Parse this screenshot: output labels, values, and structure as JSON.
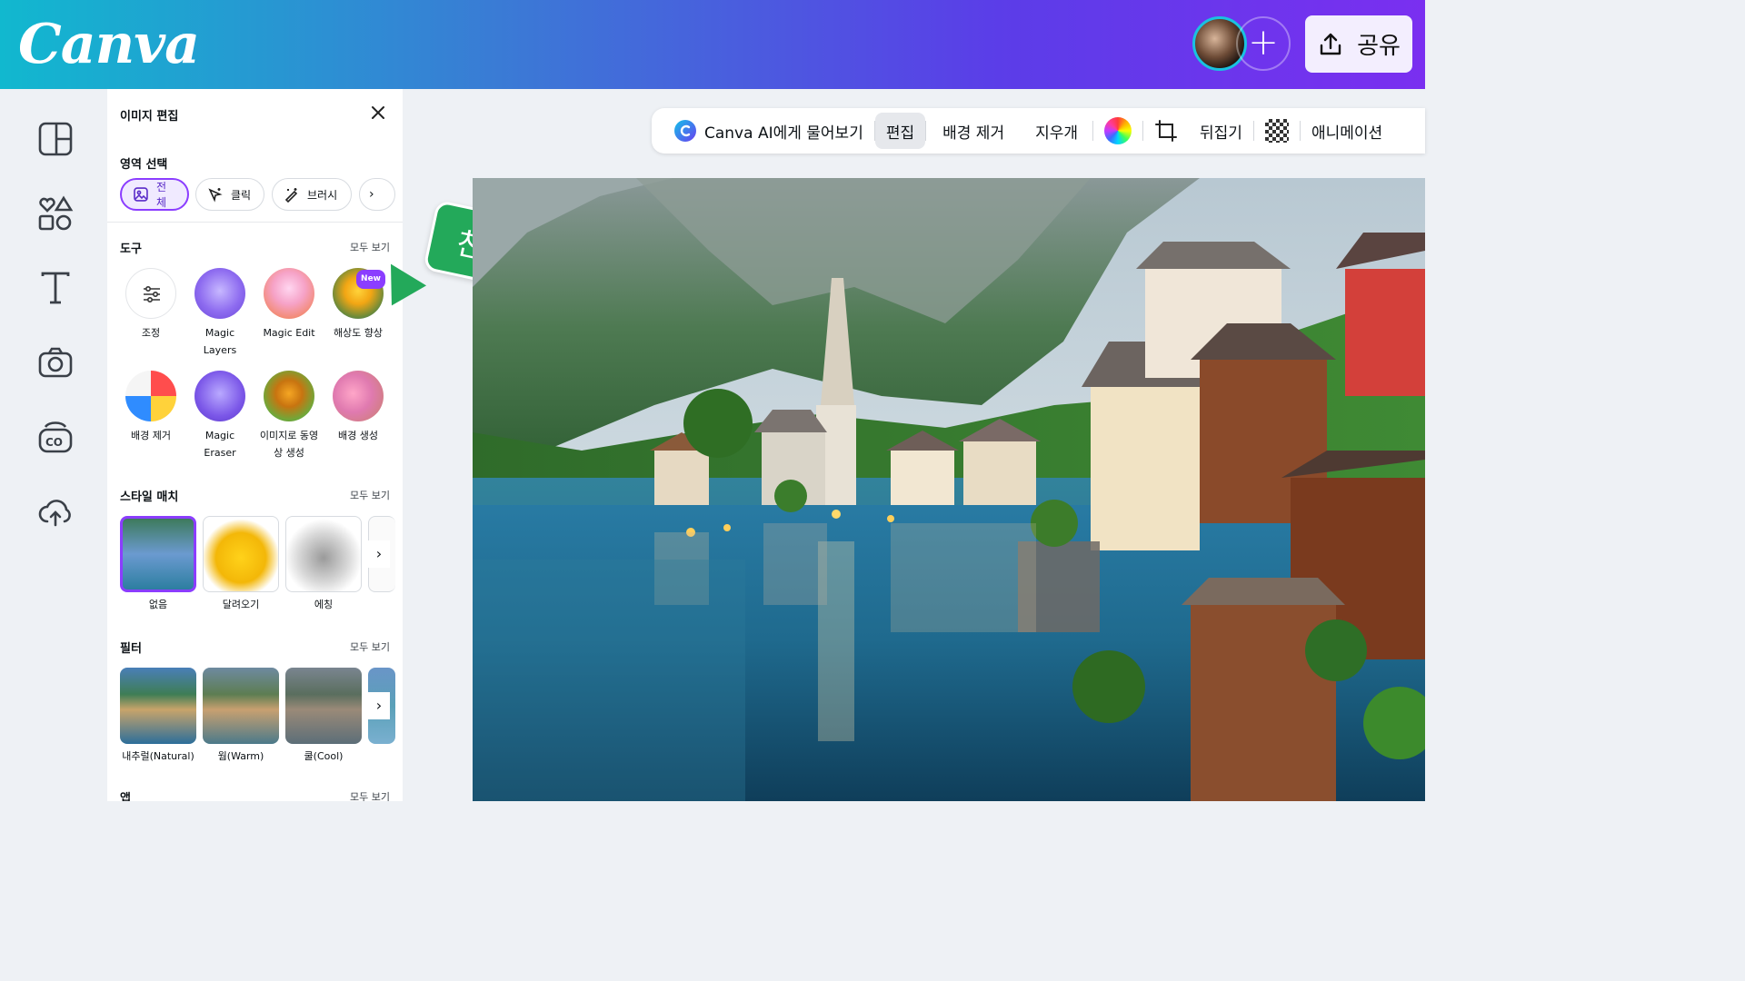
{
  "header": {
    "logo": "Canva",
    "add_collaborator": "+",
    "share_label": "공유"
  },
  "panel": {
    "title": "이미지 편집",
    "selection": {
      "title": "영역 선택",
      "chips": [
        "전체",
        "클릭",
        "브러시"
      ]
    },
    "tools": {
      "title": "도구",
      "see_all": "모두 보기",
      "items": [
        "조정",
        "Magic Layers",
        "Magic Edit",
        "해상도 향상",
        "배경 제거",
        "Magic Eraser",
        "이미지로 동영상 생성",
        "배경 생성"
      ],
      "new_badge": "New"
    },
    "style_match": {
      "title": "스타일 매치",
      "see_all": "모두 보기",
      "items": [
        "없음",
        "달려오기",
        "에칭"
      ]
    },
    "filters": {
      "title": "필터",
      "see_all": "모두 보기",
      "items": [
        "내추럴(Natural)",
        "웜(Warm)",
        "쿨(Cool)"
      ]
    },
    "apps": {
      "title": "앱",
      "see_all": "모두 보기"
    }
  },
  "toolbar": {
    "items": [
      "Canva AI에게 물어보기",
      "편집",
      "배경 제거",
      "지우개",
      "뒤집기",
      "애니메이션"
    ],
    "active_item": "편집"
  },
  "annotation_tag": "찬미",
  "colors": {
    "accent": "#8b3dff",
    "tag_green": "#23a95a",
    "header_start": "#11b8cf",
    "header_end": "#7a2ff0"
  }
}
